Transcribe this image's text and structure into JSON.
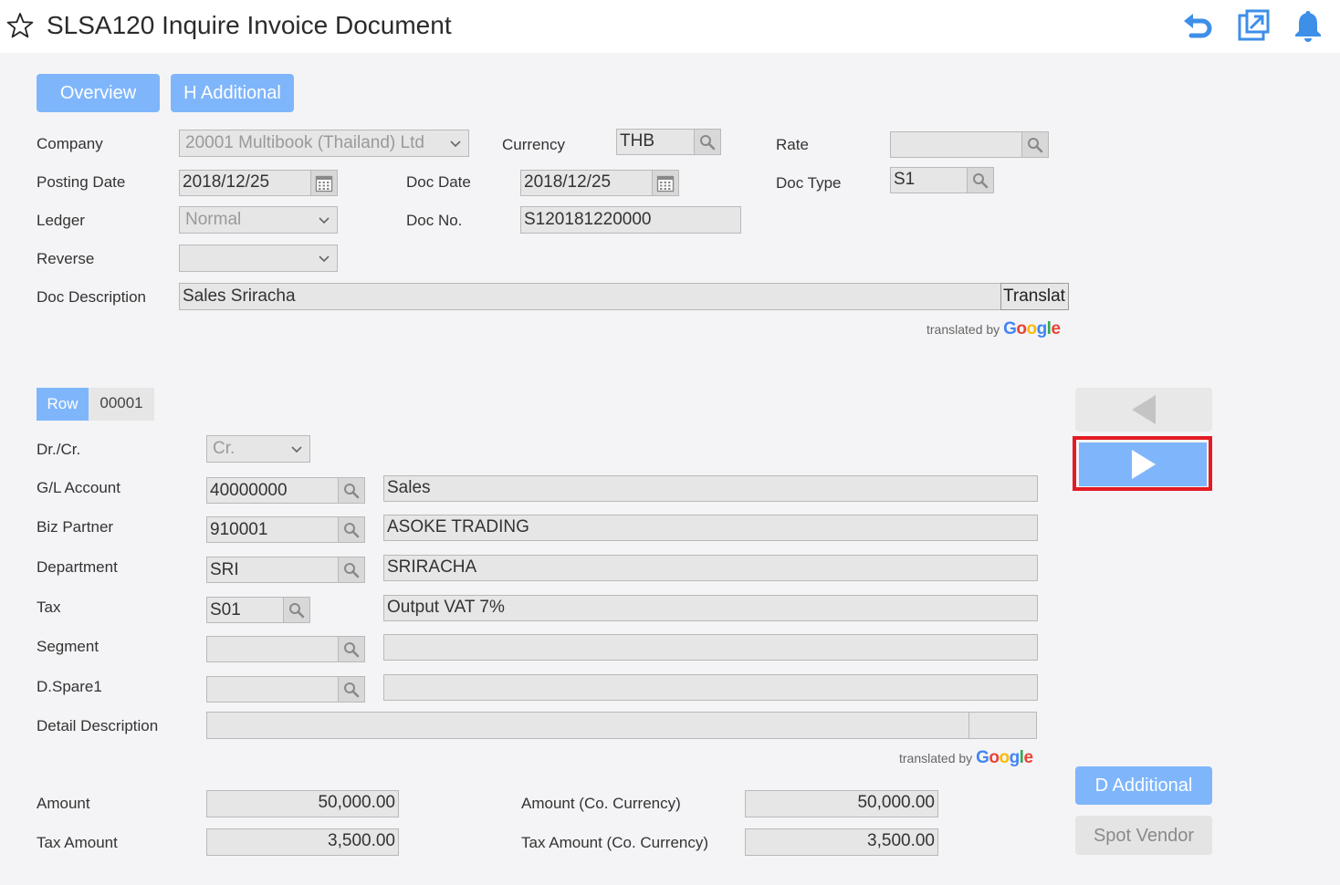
{
  "header": {
    "title": "SLSA120 Inquire Invoice Document",
    "icons": [
      "star-icon",
      "undo-icon",
      "open-external-icon",
      "bell-icon"
    ]
  },
  "tabs": {
    "overview": "Overview",
    "h_additional": "H Additional"
  },
  "form": {
    "company_label": "Company",
    "company_value": "20001 Multibook (Thailand) Ltd",
    "currency_label": "Currency",
    "currency_value": "THB",
    "rate_label": "Rate",
    "rate_value": "",
    "posting_date_label": "Posting Date",
    "posting_date_value": "2018/12/25",
    "doc_date_label": "Doc Date",
    "doc_date_value": "2018/12/25",
    "doc_type_label": "Doc Type",
    "doc_type_value": "S1",
    "ledger_label": "Ledger",
    "ledger_value": "Normal",
    "doc_no_label": "Doc No.",
    "doc_no_value": "S120181220000",
    "reverse_label": "Reverse",
    "reverse_value": "",
    "doc_description_label": "Doc Description",
    "doc_description_value": "Sales Sriracha",
    "translate_button": "Translat"
  },
  "translated_by": {
    "prefix": "translated by",
    "brand": [
      "G",
      "o",
      "o",
      "g",
      "l",
      "e"
    ]
  },
  "row": {
    "label": "Row",
    "number": "00001"
  },
  "detail": {
    "drcr_label": "Dr./Cr.",
    "drcr_value": "Cr.",
    "gl_account_label": "G/L Account",
    "gl_account_code": "40000000",
    "gl_account_name": "Sales",
    "biz_partner_label": "Biz Partner",
    "biz_partner_code": "910001",
    "biz_partner_name": "ASOKE TRADING",
    "department_label": "Department",
    "department_code": "SRI",
    "department_name": "SRIRACHA",
    "tax_label": "Tax",
    "tax_code": "S01",
    "tax_name": "Output VAT 7%",
    "segment_label": "Segment",
    "segment_code": "",
    "segment_name": "",
    "dspare1_label": "D.Spare1",
    "dspare1_code": "",
    "dspare1_name": "",
    "detail_description_label": "Detail Description",
    "detail_description_value": ""
  },
  "amounts": {
    "amount_label": "Amount",
    "amount_value": "50,000.00",
    "amount_co_label": "Amount (Co. Currency)",
    "amount_co_value": "50,000.00",
    "tax_amount_label": "Tax Amount",
    "tax_amount_value": "3,500.00",
    "tax_amount_co_label": "Tax Amount (Co. Currency)",
    "tax_amount_co_value": "3,500.00"
  },
  "side_buttons": {
    "d_additional": "D Additional",
    "spot_vendor": "Spot Vendor"
  },
  "colors": {
    "accent": "#7fb6fb",
    "highlight": "#e31b23",
    "header_icon": "#3d8fe8"
  }
}
